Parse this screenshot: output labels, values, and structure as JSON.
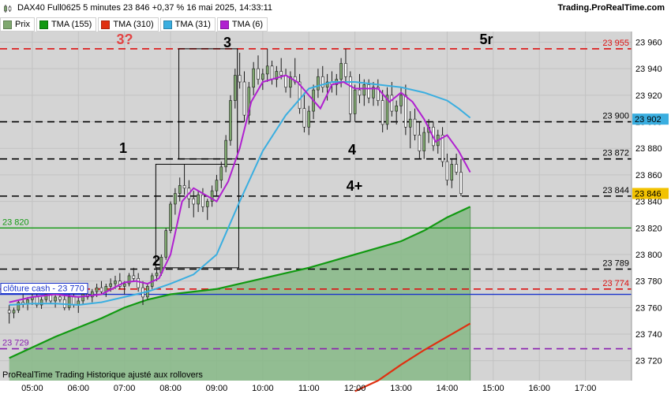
{
  "header": {
    "title": "DAX40 Full0625 5 minutes 23 846 +0,37 % 16 mai 2025, 14:33:11",
    "brand": "Trading.ProRealTime.com"
  },
  "legend": [
    {
      "label": "Prix",
      "color": "#7fa86f"
    },
    {
      "label": "TMA (155)",
      "color": "#119911"
    },
    {
      "label": "TMA (310)",
      "color": "#e03010"
    },
    {
      "label": "TMA (31)",
      "color": "#3aaee0"
    },
    {
      "label": "TMA (6)",
      "color": "#b020d0"
    }
  ],
  "footer": "ProRealTime Trading  Historique ajusté aux rollovers",
  "chart_data": {
    "type": "candlestick",
    "xlabels": [
      "05:00",
      "06:00",
      "07:00",
      "08:00",
      "09:00",
      "10:00",
      "11:00",
      "12:00",
      "13:00",
      "14:00",
      "15:00",
      "16:00",
      "17:00"
    ],
    "ylabels": [
      "23 720",
      "23 740",
      "23 760",
      "23 780",
      "23 800",
      "23 820",
      "23 840",
      "23 860",
      "23 880",
      "23 900",
      "23 920",
      "23 940",
      "23 960"
    ],
    "ylim": [
      23705,
      23968
    ],
    "levels": [
      {
        "value": 23955,
        "label": "23 955",
        "color": "#dd1111",
        "style": "dashed"
      },
      {
        "value": 23900,
        "label": "23 900",
        "color": "#000000",
        "style": "dashed"
      },
      {
        "value": 23872,
        "label": "23 872",
        "color": "#000000",
        "style": "dashed"
      },
      {
        "value": 23844,
        "label": "23 844",
        "color": "#000000",
        "style": "dashed"
      },
      {
        "value": 23820,
        "label": "23 820",
        "color": "#119911",
        "style": "solid"
      },
      {
        "value": 23789,
        "label": "23 789",
        "color": "#000000",
        "style": "dashed"
      },
      {
        "value": 23774,
        "label": "23 774",
        "color": "#dd1111",
        "style": "dashed"
      },
      {
        "value": 23770,
        "label": "clôture cash -  23 770",
        "color": "#1a33cc",
        "style": "solid"
      },
      {
        "value": 23729,
        "label": "23 729",
        "color": "#8a20b0",
        "style": "dashed"
      }
    ],
    "price_tags": [
      {
        "value": 23902,
        "label": "23 902",
        "bg": "#3aaee0"
      },
      {
        "value": 23846,
        "label": "23 846",
        "bg": "#f2c200"
      }
    ],
    "annotations": [
      "3?",
      "3",
      "5r",
      "1",
      "4",
      "4+",
      "2"
    ],
    "tma6": [
      [
        4.5,
        23764
      ],
      [
        5,
        23768
      ],
      [
        5.5,
        23770
      ],
      [
        6,
        23768
      ],
      [
        6.5,
        23770
      ],
      [
        7,
        23779
      ],
      [
        7.25,
        23780
      ],
      [
        7.5,
        23778
      ],
      [
        7.75,
        23782
      ],
      [
        8,
        23800
      ],
      [
        8.25,
        23840
      ],
      [
        8.5,
        23850
      ],
      [
        8.75,
        23845
      ],
      [
        9,
        23840
      ],
      [
        9.25,
        23855
      ],
      [
        9.5,
        23880
      ],
      [
        9.75,
        23915
      ],
      [
        10,
        23930
      ],
      [
        10.5,
        23935
      ],
      [
        10.75,
        23930
      ],
      [
        11,
        23920
      ],
      [
        11.25,
        23910
      ],
      [
        11.5,
        23928
      ],
      [
        11.75,
        23930
      ],
      [
        12,
        23925
      ],
      [
        12.5,
        23925
      ],
      [
        12.75,
        23915
      ],
      [
        13,
        23922
      ],
      [
        13.25,
        23915
      ],
      [
        13.5,
        23902
      ],
      [
        13.75,
        23885
      ],
      [
        14,
        23890
      ],
      [
        14.25,
        23878
      ],
      [
        14.5,
        23862
      ]
    ],
    "tma31": [
      [
        4.5,
        23762
      ],
      [
        5,
        23763
      ],
      [
        5.5,
        23763
      ],
      [
        6,
        23762
      ],
      [
        6.5,
        23764
      ],
      [
        7,
        23768
      ],
      [
        7.5,
        23772
      ],
      [
        8,
        23778
      ],
      [
        8.5,
        23785
      ],
      [
        9,
        23800
      ],
      [
        9.25,
        23820
      ],
      [
        9.5,
        23840
      ],
      [
        10,
        23878
      ],
      [
        10.5,
        23905
      ],
      [
        11,
        23925
      ],
      [
        11.5,
        23930
      ],
      [
        12,
        23930
      ],
      [
        12.5,
        23928
      ],
      [
        13,
        23926
      ],
      [
        13.5,
        23922
      ],
      [
        14,
        23916
      ],
      [
        14.25,
        23910
      ],
      [
        14.5,
        23903
      ]
    ],
    "tma155": [
      [
        4.5,
        23722
      ],
      [
        5,
        23730
      ],
      [
        5.5,
        23738
      ],
      [
        6,
        23745
      ],
      [
        6.5,
        23752
      ],
      [
        7,
        23760
      ],
      [
        7.5,
        23766
      ],
      [
        8,
        23770
      ],
      [
        8.5,
        23772
      ],
      [
        9,
        23774
      ],
      [
        9.5,
        23778
      ],
      [
        10,
        23782
      ],
      [
        10.5,
        23786
      ],
      [
        11,
        23790
      ],
      [
        11.5,
        23795
      ],
      [
        12,
        23800
      ],
      [
        12.5,
        23805
      ],
      [
        13,
        23810
      ],
      [
        13.5,
        23818
      ],
      [
        14,
        23828
      ],
      [
        14.5,
        23836
      ]
    ],
    "tma310": [
      [
        12,
        23697
      ],
      [
        12.5,
        23705
      ],
      [
        13,
        23717
      ],
      [
        13.5,
        23728
      ],
      [
        14,
        23738
      ],
      [
        14.5,
        23748
      ]
    ],
    "boxes": [
      {
        "t0": 8.18,
        "t1": 9.45,
        "top": 23955,
        "bottom": 23872
      },
      {
        "t0": 7.68,
        "t1": 9.48,
        "top": 23868,
        "bottom": 23790
      }
    ],
    "candles": [
      [
        4.5,
        23758,
        23762,
        23748,
        23756
      ],
      [
        4.6,
        23756,
        23760,
        23752,
        23758
      ],
      [
        4.7,
        23758,
        23766,
        23756,
        23764
      ],
      [
        4.8,
        23764,
        23770,
        23760,
        23763
      ],
      [
        4.9,
        23763,
        23768,
        23758,
        23766
      ],
      [
        5.0,
        23766,
        23772,
        23762,
        23768
      ],
      [
        5.1,
        23768,
        23770,
        23760,
        23762
      ],
      [
        5.2,
        23762,
        23768,
        23759,
        23766
      ],
      [
        5.3,
        23766,
        23772,
        23764,
        23770
      ],
      [
        5.4,
        23770,
        23772,
        23763,
        23765
      ],
      [
        5.5,
        23765,
        23770,
        23760,
        23768
      ],
      [
        5.6,
        23768,
        23772,
        23764,
        23766
      ],
      [
        5.7,
        23766,
        23769,
        23758,
        23760
      ],
      [
        5.8,
        23760,
        23770,
        23758,
        23768
      ],
      [
        5.9,
        23768,
        23772,
        23760,
        23762
      ],
      [
        6.0,
        23762,
        23768,
        23756,
        23765
      ],
      [
        6.1,
        23765,
        23772,
        23762,
        23770
      ],
      [
        6.2,
        23770,
        23776,
        23766,
        23768
      ],
      [
        6.3,
        23768,
        23774,
        23764,
        23772
      ],
      [
        6.4,
        23772,
        23778,
        23768,
        23775
      ],
      [
        6.5,
        23775,
        23780,
        23770,
        23772
      ],
      [
        6.6,
        23772,
        23778,
        23768,
        23776
      ],
      [
        6.7,
        23776,
        23782,
        23772,
        23778
      ],
      [
        6.8,
        23778,
        23784,
        23774,
        23780
      ],
      [
        6.9,
        23780,
        23786,
        23774,
        23776
      ],
      [
        7.0,
        23776,
        23780,
        23770,
        23778
      ],
      [
        7.1,
        23778,
        23786,
        23776,
        23784
      ],
      [
        7.2,
        23784,
        23790,
        23780,
        23782
      ],
      [
        7.3,
        23782,
        23786,
        23772,
        23775
      ],
      [
        7.4,
        23775,
        23780,
        23762,
        23768
      ],
      [
        7.5,
        23768,
        23778,
        23766,
        23776
      ],
      [
        7.6,
        23776,
        23786,
        23774,
        23784
      ],
      [
        7.7,
        23784,
        23790,
        23780,
        23786
      ],
      [
        7.8,
        23786,
        23800,
        23784,
        23798
      ],
      [
        7.9,
        23798,
        23820,
        23796,
        23818
      ],
      [
        8.0,
        23818,
        23840,
        23816,
        23838
      ],
      [
        8.1,
        23838,
        23850,
        23830,
        23846
      ],
      [
        8.2,
        23846,
        23858,
        23840,
        23852
      ],
      [
        8.3,
        23852,
        23868,
        23845,
        23850
      ],
      [
        8.4,
        23850,
        23856,
        23835,
        23842
      ],
      [
        8.5,
        23842,
        23848,
        23828,
        23838
      ],
      [
        8.6,
        23838,
        23848,
        23832,
        23845
      ],
      [
        8.7,
        23845,
        23850,
        23832,
        23836
      ],
      [
        8.8,
        23836,
        23842,
        23826,
        23840
      ],
      [
        8.9,
        23840,
        23852,
        23836,
        23848
      ],
      [
        9.0,
        23848,
        23860,
        23844,
        23856
      ],
      [
        9.1,
        23856,
        23870,
        23850,
        23866
      ],
      [
        9.2,
        23866,
        23890,
        23862,
        23886
      ],
      [
        9.3,
        23886,
        23920,
        23882,
        23916
      ],
      [
        9.4,
        23916,
        23940,
        23910,
        23935
      ],
      [
        9.5,
        23935,
        23952,
        23925,
        23930
      ],
      [
        9.6,
        23930,
        23938,
        23900,
        23905
      ],
      [
        9.7,
        23905,
        23930,
        23898,
        23926
      ],
      [
        9.8,
        23926,
        23945,
        23920,
        23940
      ],
      [
        9.9,
        23940,
        23950,
        23928,
        23932
      ],
      [
        10.0,
        23932,
        23940,
        23924,
        23936
      ],
      [
        10.1,
        23936,
        23955,
        23930,
        23942
      ],
      [
        10.2,
        23942,
        23946,
        23928,
        23932
      ],
      [
        10.3,
        23932,
        23942,
        23926,
        23938
      ],
      [
        10.4,
        23938,
        23948,
        23932,
        23935
      ],
      [
        10.5,
        23935,
        23940,
        23922,
        23926
      ],
      [
        10.6,
        23926,
        23938,
        23918,
        23934
      ],
      [
        10.7,
        23934,
        23948,
        23928,
        23930
      ],
      [
        10.8,
        23930,
        23936,
        23906,
        23910
      ],
      [
        10.9,
        23910,
        23922,
        23892,
        23896
      ],
      [
        11.0,
        23896,
        23912,
        23890,
        23908
      ],
      [
        11.1,
        23908,
        23928,
        23902,
        23924
      ],
      [
        11.2,
        23924,
        23940,
        23918,
        23934
      ],
      [
        11.3,
        23934,
        23942,
        23922,
        23926
      ],
      [
        11.4,
        23926,
        23936,
        23916,
        23930
      ],
      [
        11.5,
        23930,
        23938,
        23922,
        23928
      ],
      [
        11.6,
        23928,
        23936,
        23920,
        23932
      ],
      [
        11.7,
        23932,
        23948,
        23926,
        23944
      ],
      [
        11.8,
        23944,
        23955,
        23930,
        23934
      ],
      [
        11.9,
        23934,
        23938,
        23900,
        23906
      ],
      [
        12.0,
        23906,
        23928,
        23900,
        23924
      ],
      [
        12.1,
        23924,
        23936,
        23914,
        23920
      ],
      [
        12.2,
        23920,
        23932,
        23912,
        23928
      ],
      [
        12.3,
        23928,
        23932,
        23914,
        23918
      ],
      [
        12.4,
        23918,
        23930,
        23912,
        23926
      ],
      [
        12.5,
        23926,
        23932,
        23912,
        23916
      ],
      [
        12.6,
        23916,
        23924,
        23892,
        23898
      ],
      [
        12.7,
        23898,
        23926,
        23894,
        23920
      ],
      [
        12.8,
        23920,
        23930,
        23904,
        23908
      ],
      [
        12.9,
        23908,
        23916,
        23898,
        23912
      ],
      [
        13.0,
        23912,
        23926,
        23906,
        23920
      ],
      [
        13.1,
        23920,
        23928,
        23890,
        23896
      ],
      [
        13.2,
        23896,
        23908,
        23880,
        23902
      ],
      [
        13.3,
        23902,
        23910,
        23886,
        23890
      ],
      [
        13.4,
        23890,
        23900,
        23872,
        23878
      ],
      [
        13.5,
        23878,
        23896,
        23872,
        23892
      ],
      [
        13.6,
        23892,
        23902,
        23884,
        23896
      ],
      [
        13.7,
        23896,
        23900,
        23878,
        23882
      ],
      [
        13.8,
        23882,
        23894,
        23876,
        23890
      ],
      [
        13.9,
        23890,
        23896,
        23866,
        23870
      ],
      [
        14.0,
        23870,
        23876,
        23852,
        23856
      ],
      [
        14.1,
        23856,
        23872,
        23850,
        23868
      ],
      [
        14.2,
        23868,
        23876,
        23860,
        23862
      ],
      [
        14.3,
        23862,
        23872,
        23844,
        23846
      ]
    ]
  }
}
